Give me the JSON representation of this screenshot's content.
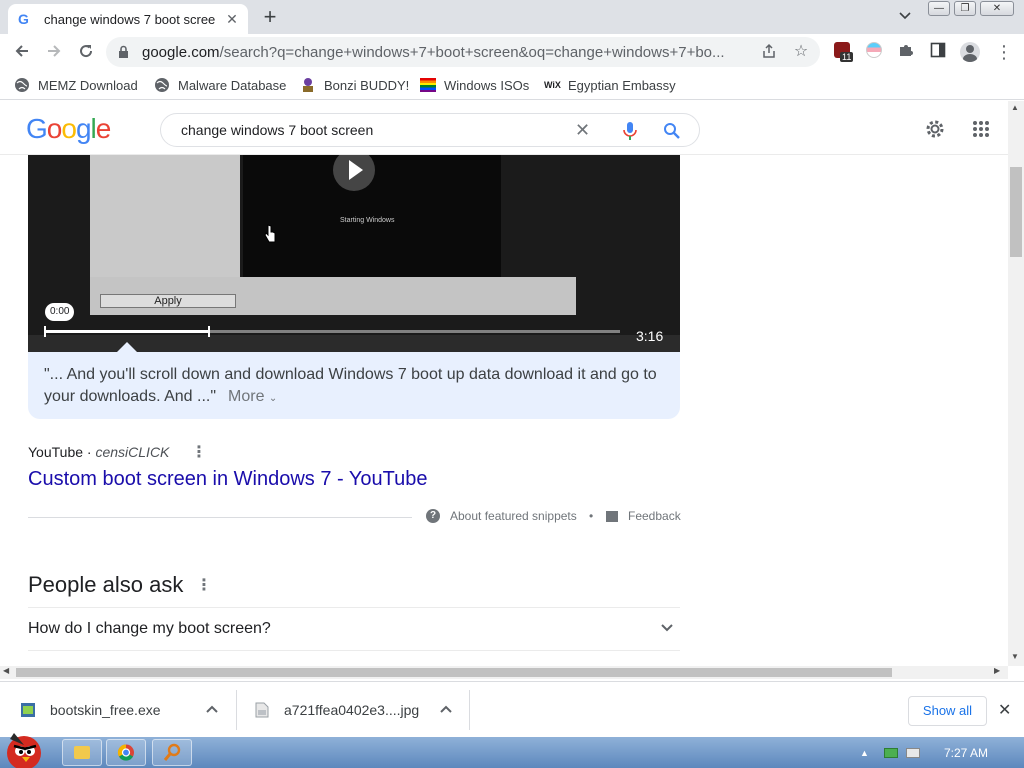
{
  "browser": {
    "tab": {
      "title": "change windows 7 boot scree",
      "favicon": "google-g-icon"
    },
    "url_host": "google.com",
    "url_path": "/search?q=change+windows+7+boot+screen&oq=change+windows+7+bo...",
    "extension_badge": "11"
  },
  "bookmarks": [
    {
      "label": "MEMZ Download",
      "icon": "globe-icon"
    },
    {
      "label": "Malware Database",
      "icon": "globe-icon"
    },
    {
      "label": "Bonzi BUDDY!",
      "icon": "bonzi-icon"
    },
    {
      "label": "Windows ISOs",
      "icon": "rainbow-flag-icon"
    },
    {
      "label": "Egyptian Embassy",
      "icon": "wix-icon"
    }
  ],
  "google": {
    "logo": "Google",
    "query": "change windows 7 boot screen"
  },
  "video": {
    "current_time": "0:00",
    "duration": "3:16",
    "progress_fraction": 0.285,
    "apply_label": "Apply",
    "screen_text": "Starting Windows"
  },
  "snippet": {
    "text": "\"... And you'll scroll down and download Windows 7 boot up data download it and go to your downloads. And ...\"",
    "more": "More"
  },
  "result": {
    "source": "YouTube",
    "author": "censiCLICK",
    "title": "Custom boot screen in Windows 7 - YouTube"
  },
  "snippet_footer": {
    "about": "About featured snippets",
    "separator": "•",
    "feedback": "Feedback"
  },
  "people_also_ask": {
    "heading": "People also ask",
    "questions": [
      "How do I change my boot screen?"
    ]
  },
  "downloads": [
    {
      "name": "bootskin_free.exe"
    },
    {
      "name": "a721ffea0402e3....jpg"
    }
  ],
  "downloads_show_all": "Show all",
  "taskbar": {
    "clock": "7:27 AM"
  },
  "colors": {
    "link": "#1a0dab",
    "snippet_bg": "#e8f0fe",
    "accent": "#1a73e8"
  }
}
